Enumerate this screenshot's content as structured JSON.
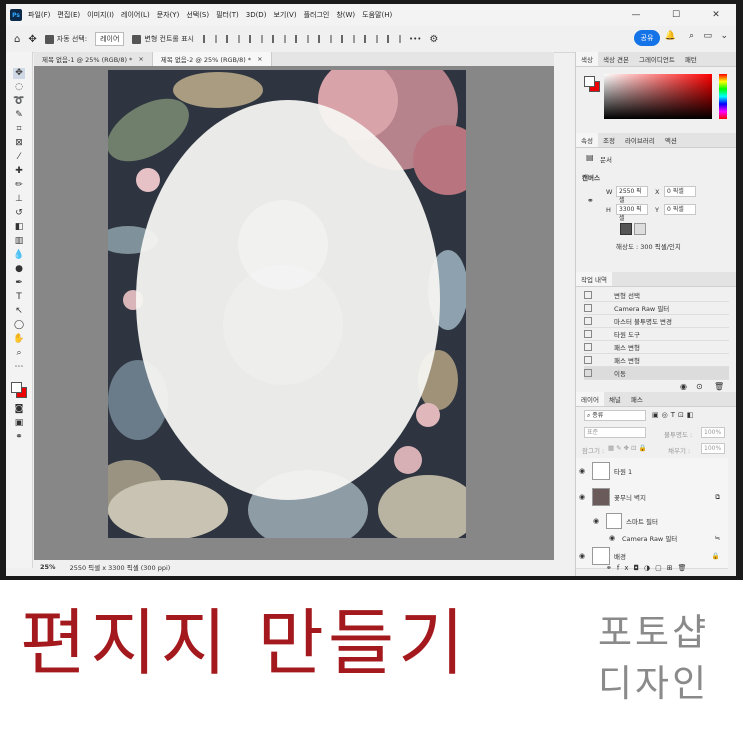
{
  "app": {
    "logo": "Ps"
  },
  "menu": [
    "파일(F)",
    "편집(E)",
    "이미지(I)",
    "레이어(L)",
    "문자(Y)",
    "선택(S)",
    "필터(T)",
    "3D(D)",
    "보기(V)",
    "플러그인",
    "창(W)",
    "도움말(H)"
  ],
  "window_controls": {
    "minimize": "—",
    "maximize": "☐",
    "close": "✕"
  },
  "options": {
    "auto_select_label": "자동 선택:",
    "auto_select_value": "레이어",
    "transform_label": "변형 컨트롤 표시",
    "more": "•••",
    "share": "공유"
  },
  "tabs": [
    "제목 없음-1 @ 25% (RGB/8) *",
    "제목 없음-2 @ 25% (RGB/8) *"
  ],
  "status": {
    "zoom": "25%",
    "info": "2550 픽셀 x 3300 픽셀 (300 ppi)"
  },
  "color_panel": {
    "tabs": [
      "색상",
      "색상 견본",
      "그레이디언트",
      "패턴"
    ]
  },
  "properties_panel": {
    "tabs": [
      "속성",
      "조정",
      "라이브러리",
      "액션"
    ],
    "doc_label": "문서",
    "canvas_label": "캔버스",
    "w_label": "W",
    "w_value": "2550 픽셀",
    "h_label": "H",
    "h_value": "3300 픽셀",
    "x_label": "X",
    "x_value": "0 픽셀",
    "y_label": "Y",
    "y_value": "0 픽셀",
    "resolution": "해상도 : 300 픽셀/인치"
  },
  "history_panel": {
    "title": "작업 내역",
    "items": [
      "변형 선택",
      "Camera Raw 필터",
      "마스터 불투명도 변경",
      "타원 도구",
      "패스 변형",
      "패스 변형",
      "이동"
    ]
  },
  "layers_panel": {
    "tabs": [
      "레이어",
      "채널",
      "패스"
    ],
    "kind": "종류",
    "blend": "표준",
    "opacity_label": "불투명도 :",
    "opacity_value": "100%",
    "lock_label": "잠그기 :",
    "fill_label": "채우기 :",
    "fill_value": "100%",
    "layers": [
      "타원 1",
      "꽃무늬 벽지",
      "스마트 필터",
      "Camera Raw 필터",
      "배경"
    ]
  },
  "banner": {
    "title": "편지지 만들기",
    "subtitle_line1": "포토샵",
    "subtitle_line2": "디자인"
  }
}
